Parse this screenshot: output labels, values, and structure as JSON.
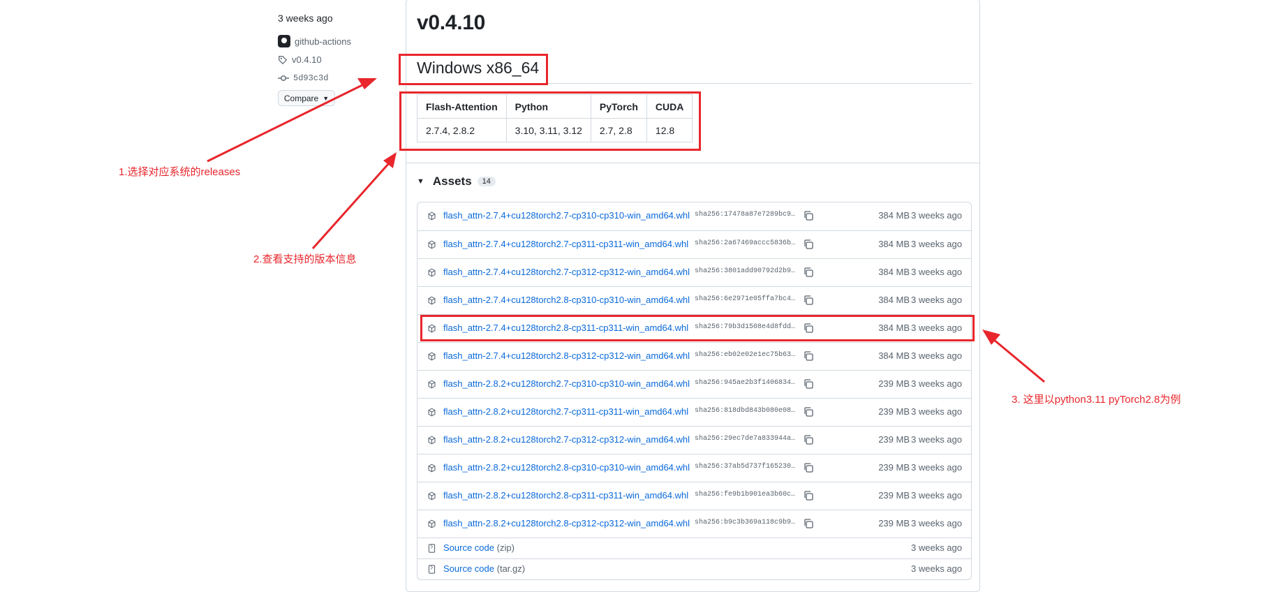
{
  "sidebar": {
    "published": "3 weeks ago",
    "actor": "github-actions",
    "tag": "v0.4.10",
    "commit": "5d93c3d",
    "compare_label": "Compare"
  },
  "release": {
    "version": "v0.4.10",
    "section_title": "Windows x86_64",
    "compat_headers": [
      "Flash-Attention",
      "Python",
      "PyTorch",
      "CUDA"
    ],
    "compat_values": [
      "2.7.4, 2.8.2",
      "3.10, 3.11, 3.12",
      "2.7, 2.8",
      "12.8"
    ]
  },
  "assets": {
    "title": "Assets",
    "count": "14",
    "items": [
      {
        "name": "flash_attn-2.7.4+cu128torch2.7-cp310-cp310-win_amd64.whl",
        "sha": "sha256:17478a87e7289bc9…",
        "size": "384 MB",
        "date": "3 weeks ago"
      },
      {
        "name": "flash_attn-2.7.4+cu128torch2.7-cp311-cp311-win_amd64.whl",
        "sha": "sha256:2a67469accc5836b…",
        "size": "384 MB",
        "date": "3 weeks ago"
      },
      {
        "name": "flash_attn-2.7.4+cu128torch2.7-cp312-cp312-win_amd64.whl",
        "sha": "sha256:3801add90792d2b9…",
        "size": "384 MB",
        "date": "3 weeks ago"
      },
      {
        "name": "flash_attn-2.7.4+cu128torch2.8-cp310-cp310-win_amd64.whl",
        "sha": "sha256:6e2971e05ffa7bc4…",
        "size": "384 MB",
        "date": "3 weeks ago"
      },
      {
        "name": "flash_attn-2.7.4+cu128torch2.8-cp311-cp311-win_amd64.whl",
        "sha": "sha256:79b3d1508e4d8fdd…",
        "size": "384 MB",
        "date": "3 weeks ago"
      },
      {
        "name": "flash_attn-2.7.4+cu128torch2.8-cp312-cp312-win_amd64.whl",
        "sha": "sha256:eb02e02e1ec75b63…",
        "size": "384 MB",
        "date": "3 weeks ago"
      },
      {
        "name": "flash_attn-2.8.2+cu128torch2.7-cp310-cp310-win_amd64.whl",
        "sha": "sha256:945ae2b3f1406834…",
        "size": "239 MB",
        "date": "3 weeks ago"
      },
      {
        "name": "flash_attn-2.8.2+cu128torch2.7-cp311-cp311-win_amd64.whl",
        "sha": "sha256:818dbd843b080e08…",
        "size": "239 MB",
        "date": "3 weeks ago"
      },
      {
        "name": "flash_attn-2.8.2+cu128torch2.7-cp312-cp312-win_amd64.whl",
        "sha": "sha256:29ec7de7a833944a…",
        "size": "239 MB",
        "date": "3 weeks ago"
      },
      {
        "name": "flash_attn-2.8.2+cu128torch2.8-cp310-cp310-win_amd64.whl",
        "sha": "sha256:37ab5d737f165230…",
        "size": "239 MB",
        "date": "3 weeks ago"
      },
      {
        "name": "flash_attn-2.8.2+cu128torch2.8-cp311-cp311-win_amd64.whl",
        "sha": "sha256:fe9b1b901ea3b60c…",
        "size": "239 MB",
        "date": "3 weeks ago"
      },
      {
        "name": "flash_attn-2.8.2+cu128torch2.8-cp312-cp312-win_amd64.whl",
        "sha": "sha256:b9c3b369a118c9b9…",
        "size": "239 MB",
        "date": "3 weeks ago"
      }
    ],
    "source_zip": {
      "label": "Source code",
      "ext": "(zip)",
      "date": "3 weeks ago"
    },
    "source_tar": {
      "label": "Source code",
      "ext": "(tar.gz)",
      "date": "3 weeks ago"
    }
  },
  "annotations": {
    "step1": "1.选择对应系统的releases",
    "step2": "2.查看支持的版本信息",
    "step3": "3. 这里以python3.11  pyTorch2.8为例",
    "color": "#e8262c"
  },
  "colors": {
    "link": "#0969da",
    "muted": "#59636e",
    "border": "#d1d9e0"
  },
  "icons": {
    "asset": "package-icon",
    "copy": "copy-icon",
    "tag": "tag-icon",
    "commit": "commit-icon",
    "source": "file-zip-icon"
  }
}
